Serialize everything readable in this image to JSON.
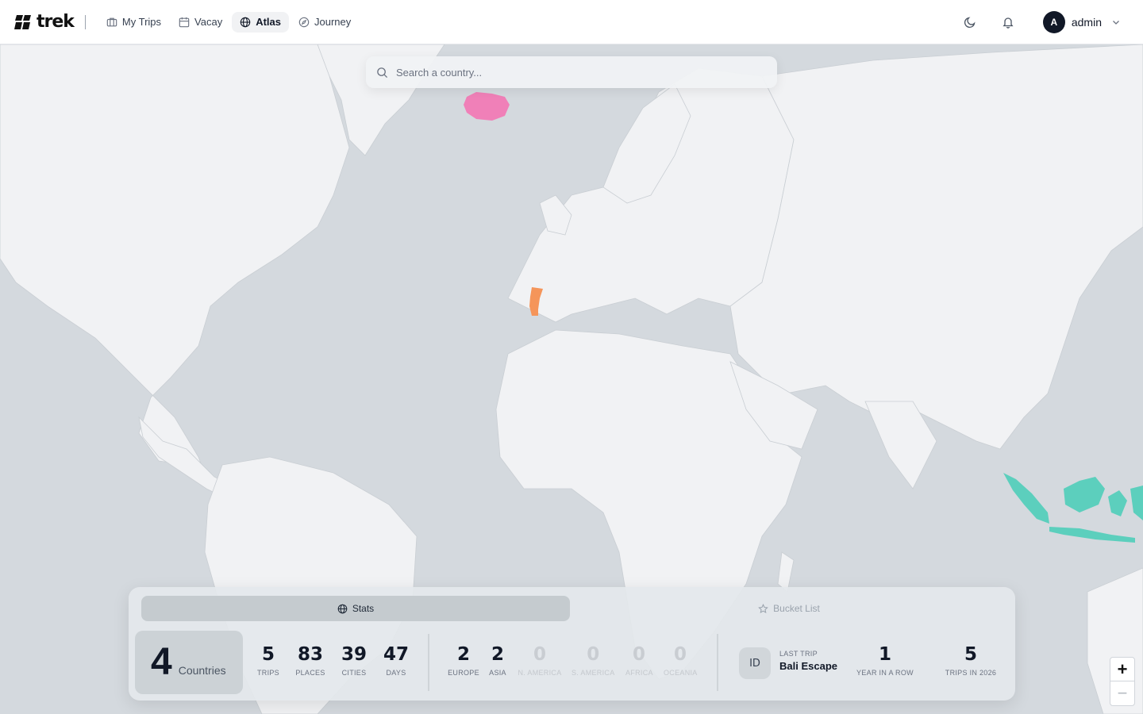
{
  "app": {
    "name": "trek"
  },
  "nav": [
    {
      "label": "My Trips",
      "icon": "briefcase-icon",
      "active": false
    },
    {
      "label": "Vacay",
      "icon": "calendar-icon",
      "active": false
    },
    {
      "label": "Atlas",
      "icon": "globe-icon",
      "active": true
    },
    {
      "label": "Journey",
      "icon": "compass-icon",
      "active": false
    }
  ],
  "user": {
    "initial": "A",
    "name": "admin"
  },
  "search": {
    "placeholder": "Search a country..."
  },
  "tabs": {
    "stats": "Stats",
    "bucket": "Bucket List"
  },
  "summary": {
    "countries": "4",
    "countries_label": "Countries"
  },
  "stats": [
    {
      "value": "5",
      "label": "Trips"
    },
    {
      "value": "83",
      "label": "Places"
    },
    {
      "value": "39",
      "label": "Cities"
    },
    {
      "value": "47",
      "label": "Days"
    }
  ],
  "continents": [
    {
      "value": "2",
      "label": "Europe"
    },
    {
      "value": "2",
      "label": "Asia"
    },
    {
      "value": "0",
      "label": "N. America"
    },
    {
      "value": "0",
      "label": "S. America"
    },
    {
      "value": "0",
      "label": "Africa"
    },
    {
      "value": "0",
      "label": "Oceania"
    }
  ],
  "last_trip": {
    "code": "ID",
    "caption": "LAST TRIP",
    "name": "Bali Escape"
  },
  "streak": {
    "value": "1",
    "label": "Year in a row"
  },
  "year_trips": {
    "value": "5",
    "label": "Trips in 2026"
  },
  "zoom": {
    "in": "+",
    "out": "−"
  },
  "colors": {
    "iceland": "#f080b8",
    "portugal": "#f5955a",
    "indonesia": "#5ccfbd",
    "ocean": "#d4d9de",
    "land": "#f1f2f4"
  }
}
